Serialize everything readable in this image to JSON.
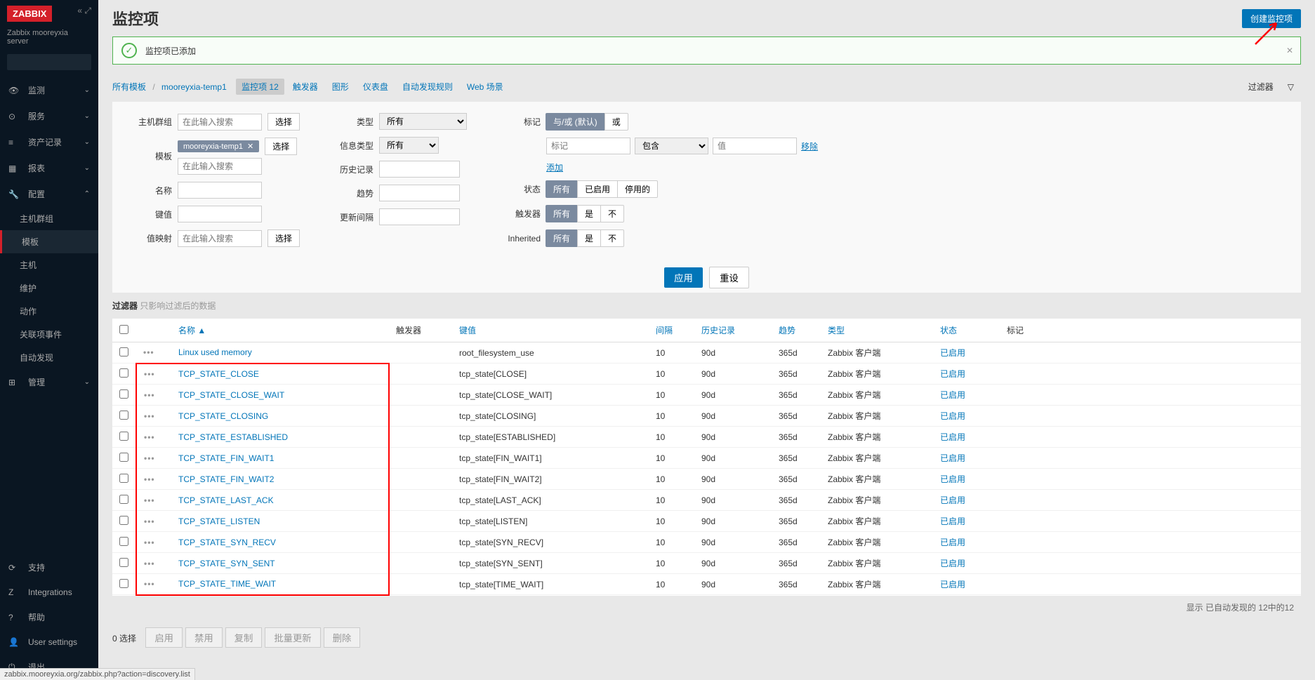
{
  "logo": "ZABBIX",
  "server_name": "Zabbix mooreyxia server",
  "sidebar": {
    "sections": [
      {
        "icon": "👁",
        "label": "监测"
      },
      {
        "icon": "⊙",
        "label": "服务"
      },
      {
        "icon": "≡",
        "label": "资产记录"
      },
      {
        "icon": "▦",
        "label": "报表"
      },
      {
        "icon": "🔧",
        "label": "配置"
      }
    ],
    "config_subs": [
      {
        "label": "主机群组"
      },
      {
        "label": "模板"
      },
      {
        "label": "主机"
      },
      {
        "label": "维护"
      },
      {
        "label": "动作"
      },
      {
        "label": "关联项事件"
      },
      {
        "label": "自动发现"
      }
    ],
    "manage": {
      "icon": "⊞",
      "label": "管理"
    },
    "bottom": [
      {
        "icon": "⟳",
        "label": "支持"
      },
      {
        "icon": "Z",
        "label": "Integrations"
      },
      {
        "icon": "?",
        "label": "帮助"
      },
      {
        "icon": "👤",
        "label": "User settings"
      },
      {
        "icon": "⏻",
        "label": "退出"
      }
    ]
  },
  "page_title": "监控项",
  "create_btn": "创建监控项",
  "success_msg": "监控项已添加",
  "breadcrumb": {
    "all_templates": "所有模板",
    "template_name": "mooreyxia-temp1",
    "tabs": [
      {
        "label": "监控项 12",
        "active": true
      },
      {
        "label": "触发器"
      },
      {
        "label": "图形"
      },
      {
        "label": "仪表盘"
      },
      {
        "label": "自动发现规则"
      },
      {
        "label": "Web 场景"
      }
    ]
  },
  "filter_toggle": "过滤器",
  "filter": {
    "host_group": {
      "label": "主机群组",
      "placeholder": "在此输入搜索",
      "btn": "选择"
    },
    "template": {
      "label": "模板",
      "chip": "mooreyxia-temp1",
      "placeholder": "在此输入搜索",
      "btn": "选择"
    },
    "name": {
      "label": "名称"
    },
    "key": {
      "label": "键值"
    },
    "valuemap": {
      "label": "值映射",
      "placeholder": "在此输入搜索",
      "btn": "选择"
    },
    "type": {
      "label": "类型",
      "value": "所有"
    },
    "info_type": {
      "label": "信息类型",
      "value": "所有"
    },
    "history": {
      "label": "历史记录"
    },
    "trends": {
      "label": "趋势"
    },
    "update_interval": {
      "label": "更新间隔"
    },
    "tags_label": "标记",
    "tags_mode": {
      "and_or": "与/或 (默认)",
      "or": "或"
    },
    "tag_placeholder": "标记",
    "tag_op": "包含",
    "tag_value": "值",
    "remove": "移除",
    "add": "添加",
    "status": {
      "label": "状态",
      "opts": [
        "所有",
        "已启用",
        "停用的"
      ]
    },
    "triggers": {
      "label": "触发器",
      "opts": [
        "所有",
        "是",
        "不"
      ]
    },
    "inherited": {
      "label": "Inherited",
      "opts": [
        "所有",
        "是",
        "不"
      ]
    },
    "apply": "应用",
    "reset": "重设"
  },
  "filter_info": {
    "bold": "过滤器",
    "text": "只影响过滤后的数据"
  },
  "table": {
    "headers": {
      "name": "名称",
      "triggers": "触发器",
      "key": "键值",
      "interval": "间隔",
      "history": "历史记录",
      "trends": "趋势",
      "type": "类型",
      "status": "状态",
      "tags": "标记"
    },
    "rows": [
      {
        "name": "Linux used memory",
        "key": "root_filesystem_use",
        "interval": "10",
        "history": "90d",
        "trends": "365d",
        "type": "Zabbix 客户端",
        "status": "已启用",
        "highlight": false
      },
      {
        "name": "TCP_STATE_CLOSE",
        "key": "tcp_state[CLOSE]",
        "interval": "10",
        "history": "90d",
        "trends": "365d",
        "type": "Zabbix 客户端",
        "status": "已启用",
        "highlight": true
      },
      {
        "name": "TCP_STATE_CLOSE_WAIT",
        "key": "tcp_state[CLOSE_WAIT]",
        "interval": "10",
        "history": "90d",
        "trends": "365d",
        "type": "Zabbix 客户端",
        "status": "已启用",
        "highlight": true
      },
      {
        "name": "TCP_STATE_CLOSING",
        "key": "tcp_state[CLOSING]",
        "interval": "10",
        "history": "90d",
        "trends": "365d",
        "type": "Zabbix 客户端",
        "status": "已启用",
        "highlight": true
      },
      {
        "name": "TCP_STATE_ESTABLISHED",
        "key": "tcp_state[ESTABLISHED]",
        "interval": "10",
        "history": "90d",
        "trends": "365d",
        "type": "Zabbix 客户端",
        "status": "已启用",
        "highlight": true
      },
      {
        "name": "TCP_STATE_FIN_WAIT1",
        "key": "tcp_state[FIN_WAIT1]",
        "interval": "10",
        "history": "90d",
        "trends": "365d",
        "type": "Zabbix 客户端",
        "status": "已启用",
        "highlight": true
      },
      {
        "name": "TCP_STATE_FIN_WAIT2",
        "key": "tcp_state[FIN_WAIT2]",
        "interval": "10",
        "history": "90d",
        "trends": "365d",
        "type": "Zabbix 客户端",
        "status": "已启用",
        "highlight": true
      },
      {
        "name": "TCP_STATE_LAST_ACK",
        "key": "tcp_state[LAST_ACK]",
        "interval": "10",
        "history": "90d",
        "trends": "365d",
        "type": "Zabbix 客户端",
        "status": "已启用",
        "highlight": true
      },
      {
        "name": "TCP_STATE_LISTEN",
        "key": "tcp_state[LISTEN]",
        "interval": "10",
        "history": "90d",
        "trends": "365d",
        "type": "Zabbix 客户端",
        "status": "已启用",
        "highlight": true
      },
      {
        "name": "TCP_STATE_SYN_RECV",
        "key": "tcp_state[SYN_RECV]",
        "interval": "10",
        "history": "90d",
        "trends": "365d",
        "type": "Zabbix 客户端",
        "status": "已启用",
        "highlight": true
      },
      {
        "name": "TCP_STATE_SYN_SENT",
        "key": "tcp_state[SYN_SENT]",
        "interval": "10",
        "history": "90d",
        "trends": "365d",
        "type": "Zabbix 客户端",
        "status": "已启用",
        "highlight": true
      },
      {
        "name": "TCP_STATE_TIME_WAIT",
        "key": "tcp_state[TIME_WAIT]",
        "interval": "10",
        "history": "90d",
        "trends": "365d",
        "type": "Zabbix 客户端",
        "status": "已启用",
        "highlight": true
      }
    ],
    "footer": "显示 已自动发现的 12中的12"
  },
  "action_bar": {
    "selected": "0 选择",
    "buttons": [
      "启用",
      "禁用",
      "复制",
      "批量更新",
      "删除"
    ]
  },
  "status_url": "zabbix.mooreyxia.org/zabbix.php?action=discovery.list"
}
